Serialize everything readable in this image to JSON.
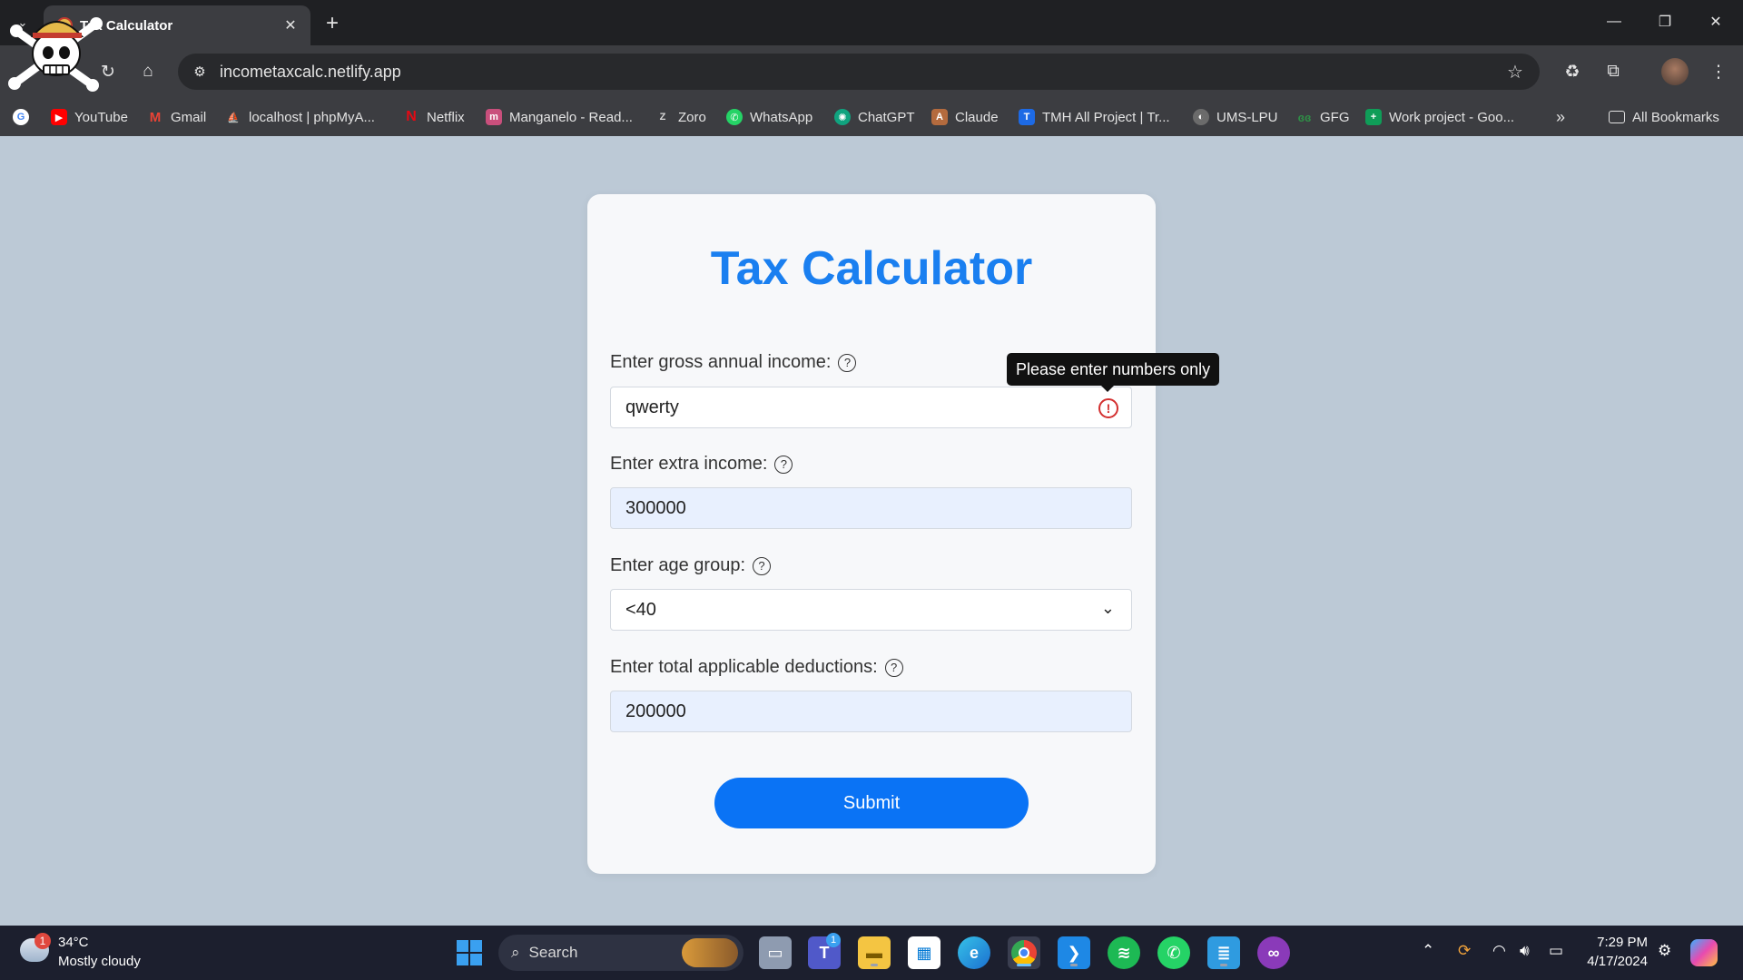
{
  "browser": {
    "tab_title": "Tax Calculator",
    "url": "incometaxcalc.netlify.app",
    "bookmarks": [
      {
        "label": "YouTube",
        "color": "#ff0000",
        "glyph": "▶"
      },
      {
        "label": "Gmail",
        "color": "#ea4335",
        "glyph": "M"
      },
      {
        "label": "localhost | phpMyA...",
        "color": "#f29111",
        "glyph": "⛵"
      },
      {
        "label": "Netflix",
        "color": "#e50914",
        "glyph": "N"
      },
      {
        "label": "Manganelo - Read...",
        "color": "#c94f7c",
        "glyph": "m"
      },
      {
        "label": "Zoro",
        "color": "#7a7a7a",
        "glyph": "Z"
      },
      {
        "label": "WhatsApp",
        "color": "#25d366",
        "glyph": "✆"
      },
      {
        "label": "ChatGPT",
        "color": "#10a37f",
        "glyph": "✺"
      },
      {
        "label": "Claude",
        "color": "#b46b3e",
        "glyph": "A"
      },
      {
        "label": "TMH All Project | Tr...",
        "color": "#1d6ae5",
        "glyph": "T"
      },
      {
        "label": "UMS-LPU",
        "color": "#6b6b6b",
        "glyph": "◐"
      },
      {
        "label": "GFG",
        "color": "#2f8d46",
        "glyph": "G"
      },
      {
        "label": "Work project - Goo...",
        "color": "#0f9d58",
        "glyph": "+"
      }
    ],
    "all_bookmarks": "All Bookmarks"
  },
  "page": {
    "title": "Tax Calculator",
    "gross_income": {
      "label": "Enter gross annual income:",
      "value": "qwerty"
    },
    "extra_income": {
      "label": "Enter extra income:",
      "value": "300000"
    },
    "age_group": {
      "label": "Enter age group:",
      "value": "<40"
    },
    "deductions": {
      "label": "Enter total applicable deductions:",
      "value": "200000"
    },
    "tooltip": "Please enter numbers only",
    "submit": "Submit",
    "accent_color": "#1a7ff0",
    "error_color": "#d32f2f"
  },
  "taskbar": {
    "weather_badge": "1",
    "temperature": "34°C",
    "condition": "Mostly cloudy",
    "search_label": "Search",
    "teams_badge": "1",
    "time": "7:29 PM",
    "date": "4/17/2024"
  }
}
